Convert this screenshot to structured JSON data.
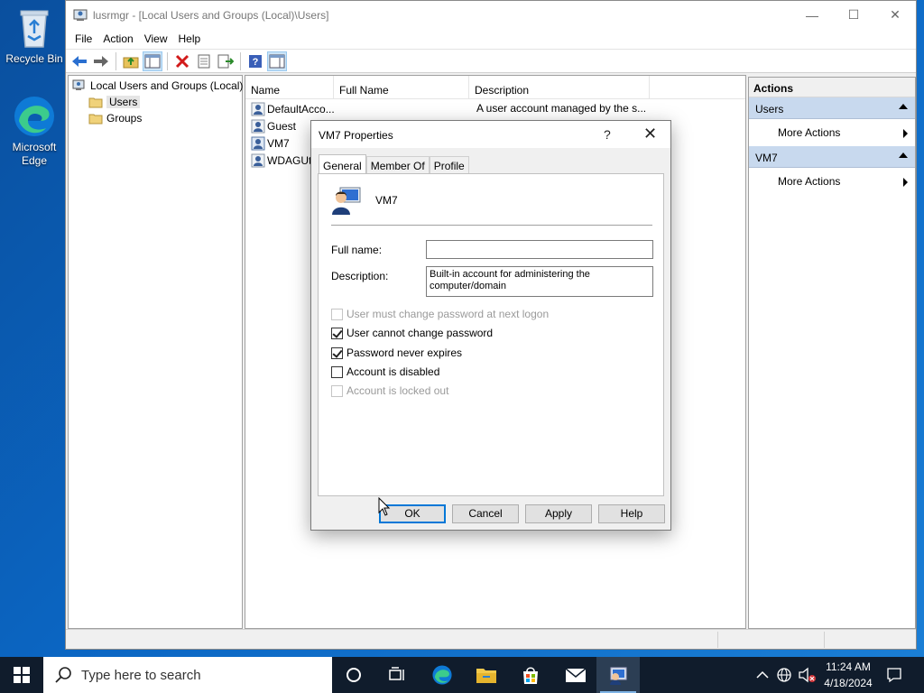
{
  "desktop": {
    "icons": [
      {
        "label": "Recycle Bin",
        "icon": "recycle-bin-icon"
      },
      {
        "label": "Microsoft Edge",
        "icon": "edge-icon"
      }
    ]
  },
  "window": {
    "title": "lusrmgr - [Local Users and Groups (Local)\\Users]",
    "controls": {
      "minimize": "—",
      "maximize": "☐",
      "close": "✕"
    }
  },
  "menu": [
    "File",
    "Action",
    "View",
    "Help"
  ],
  "toolbar": [
    "back-icon",
    "forward-icon",
    "up-folder-icon",
    "show-hide-tree-icon",
    "delete-icon",
    "properties-icon",
    "export-list-icon",
    "help-icon",
    "show-hide-action-pane-icon"
  ],
  "tree": {
    "root": "Local Users and Groups (Local)",
    "items": [
      {
        "label": "Users",
        "selected": true
      },
      {
        "label": "Groups",
        "selected": false
      }
    ]
  },
  "list": {
    "columns": [
      "Name",
      "Full Name",
      "Description"
    ],
    "rows": [
      {
        "name": "DefaultAcco...",
        "full_name": "",
        "description": "A user account managed by the s..."
      },
      {
        "name": "Guest",
        "full_name": "",
        "description": ""
      },
      {
        "name": "VM7",
        "full_name": "",
        "description": ""
      },
      {
        "name": "WDAGUti",
        "full_name": "",
        "description": ""
      }
    ]
  },
  "actions": {
    "header": "Actions",
    "groups": [
      {
        "label": "Users",
        "items": [
          "More Actions"
        ]
      },
      {
        "label": "VM7",
        "items": [
          "More Actions"
        ]
      }
    ]
  },
  "dialog": {
    "title": "VM7 Properties",
    "help_glyph": "?",
    "close_glyph": "✕",
    "tabs": [
      {
        "label": "General",
        "active": true
      },
      {
        "label": "Member Of",
        "active": false
      },
      {
        "label": "Profile",
        "active": false
      }
    ],
    "user_name": "VM7",
    "full_name_label": "Full name:",
    "full_name_value": "",
    "description_label": "Description:",
    "description_value": "Built-in account for administering the computer/domain",
    "checkboxes": [
      {
        "label": "User must change password at next logon",
        "checked": false,
        "enabled": false
      },
      {
        "label": "User cannot change password",
        "checked": true,
        "enabled": true
      },
      {
        "label": "Password never expires",
        "checked": true,
        "enabled": true
      },
      {
        "label": "Account is disabled",
        "checked": false,
        "enabled": true
      },
      {
        "label": "Account is locked out",
        "checked": false,
        "enabled": false
      }
    ],
    "buttons": {
      "ok": "OK",
      "cancel": "Cancel",
      "apply": "Apply",
      "help": "Help"
    }
  },
  "taskbar": {
    "search_placeholder": "Type here to search",
    "pinned": [
      "task-view-icon",
      "edge-icon",
      "file-explorer-icon",
      "store-icon",
      "mail-icon",
      "lusrmgr-icon"
    ],
    "time": "11:24 AM",
    "date": "4/18/2024"
  }
}
